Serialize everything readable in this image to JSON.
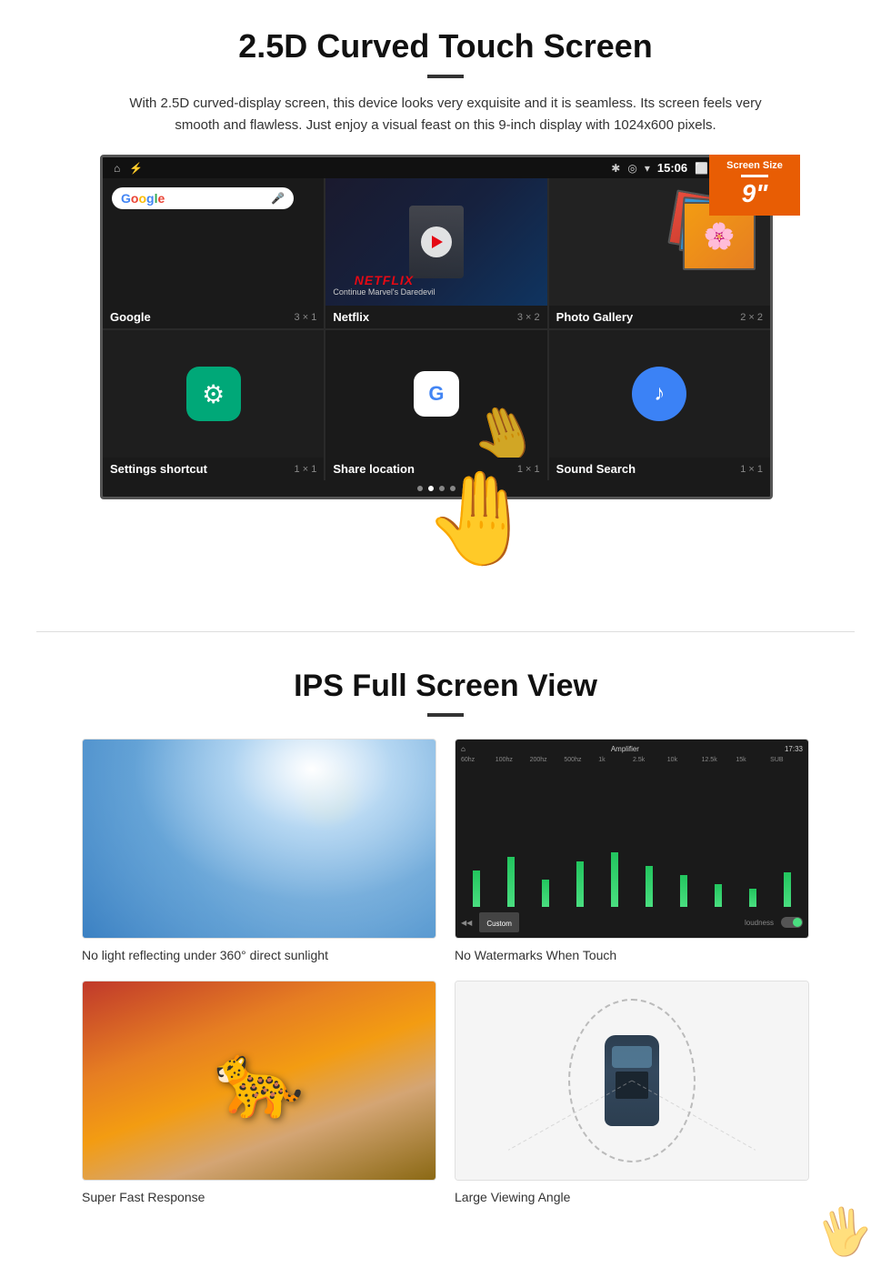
{
  "section1": {
    "title": "2.5D Curved Touch Screen",
    "description": "With 2.5D curved-display screen, this device looks very exquisite and it is seamless. Its screen feels very smooth and flawless. Just enjoy a visual feast on this 9-inch display with 1024x600 pixels.",
    "screen_size_badge": {
      "label": "Screen Size",
      "size": "9\""
    },
    "status_bar": {
      "time": "15:06"
    },
    "app_cells": [
      {
        "name": "Google",
        "size": "3 × 1"
      },
      {
        "name": "Netflix",
        "size": "3 × 2",
        "netflix_label": "NETFLIX",
        "netflix_subtitle": "Continue Marvel's Daredevil"
      },
      {
        "name": "Photo Gallery",
        "size": "2 × 2"
      },
      {
        "name": "Settings shortcut",
        "size": "1 × 1"
      },
      {
        "name": "Share location",
        "size": "1 × 1"
      },
      {
        "name": "Sound Search",
        "size": "1 × 1"
      }
    ]
  },
  "section2": {
    "title": "IPS Full Screen View",
    "features": [
      {
        "caption": "No light reflecting under 360° direct sunlight"
      },
      {
        "caption": "No Watermarks When Touch"
      },
      {
        "caption": "Super Fast Response"
      },
      {
        "caption": "Large Viewing Angle"
      }
    ]
  }
}
